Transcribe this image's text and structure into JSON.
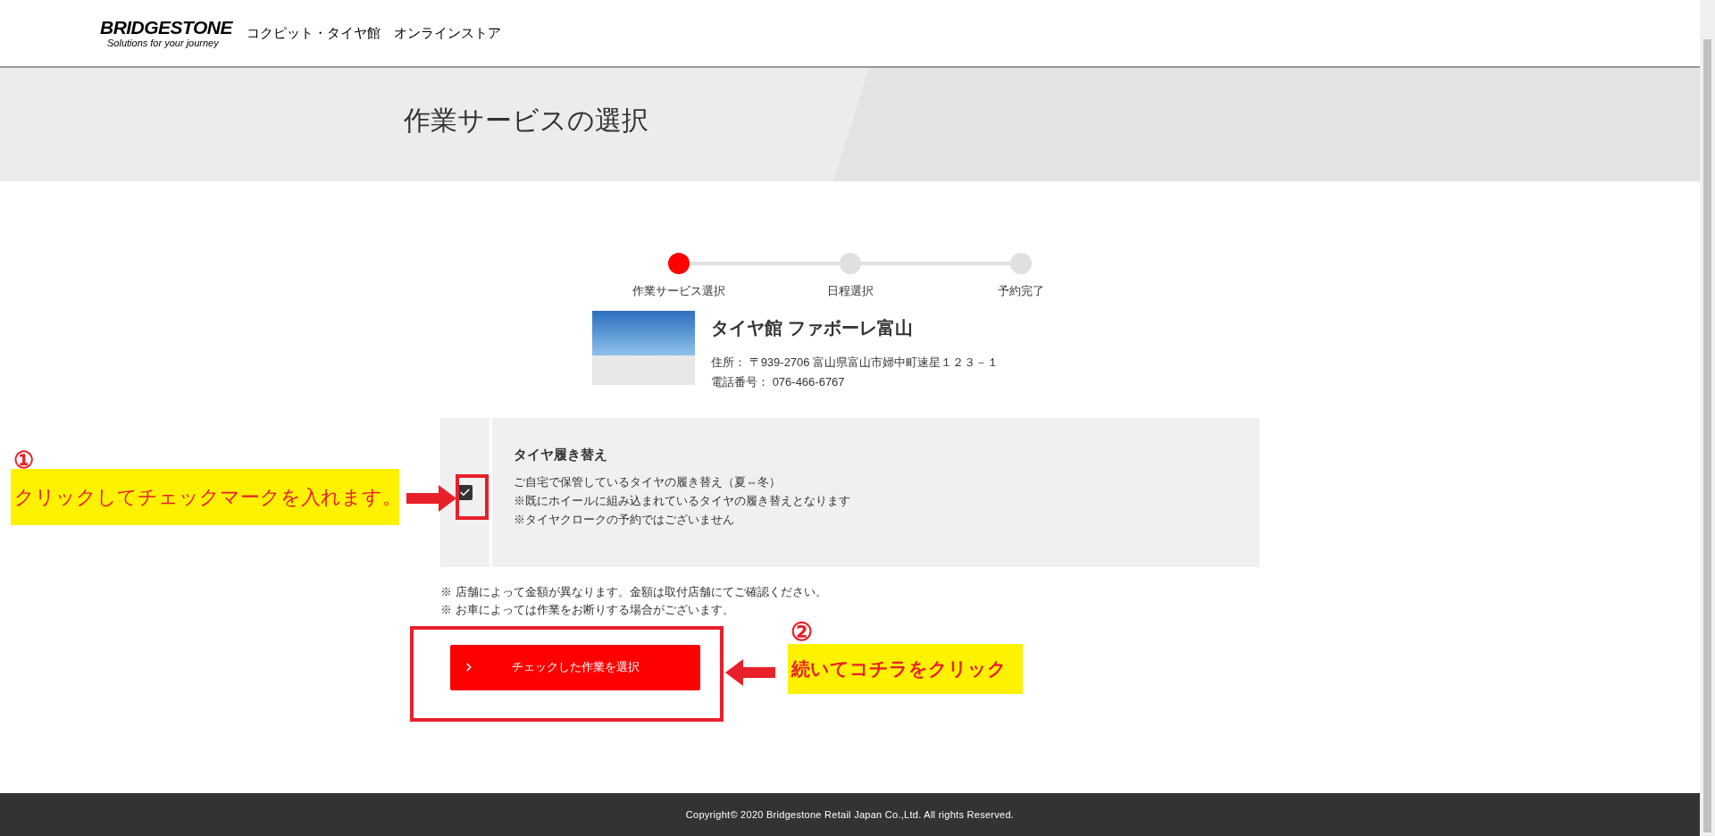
{
  "header": {
    "brand": "BRIDGESTONE",
    "tagline": "Solutions for your journey",
    "site_title": "コクピット・タイヤ館　オンラインストア"
  },
  "page_title": "作業サービスの選択",
  "steps": [
    {
      "label": "作業サービス選択",
      "selected": true
    },
    {
      "label": "日程選択",
      "selected": false
    },
    {
      "label": "予約完了",
      "selected": false
    }
  ],
  "shop": {
    "name": "タイヤ館 ファボーレ富山",
    "address_label": "住所：",
    "address": "〒939-2706 富山県富山市婦中町速星１２３－１",
    "phone_label": "電話番号：",
    "phone": "076-466-6767"
  },
  "services": [
    {
      "title": "タイヤ履き替え",
      "checked": true,
      "description": [
        "ご自宅で保管しているタイヤの履き替え（夏⇔冬）",
        "※既にホイールに組み込まれているタイヤの履き替えとなります",
        "※タイヤクロークの予約ではございません"
      ]
    }
  ],
  "notes": [
    "※ 店舗によって金額が異なります。金額は取付店舗にてご確認ください。",
    "※ お車によっては作業をお断りする場合がございます。"
  ],
  "submit_button": {
    "label": "チェックした作業を選択"
  },
  "annotations": [
    {
      "number": "①",
      "text": "クリックしてチェックマークを入れます。"
    },
    {
      "number": "②",
      "text": "続いてコチラをクリック"
    }
  ],
  "footer": {
    "copyright": "Copyright© 2020 Bridgestone Retail Japan Co.,Ltd. All rights Reserved."
  }
}
